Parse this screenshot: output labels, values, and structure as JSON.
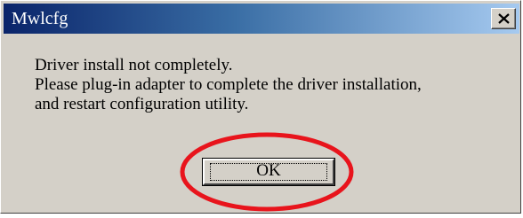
{
  "window": {
    "title": "Mwlcfg",
    "close_glyph": "X"
  },
  "message": {
    "lines": [
      "Driver install not completely.",
      "Please plug-in adapter to complete the driver installation,",
      "and restart configuration utility."
    ]
  },
  "buttons": {
    "ok_label": "OK"
  },
  "colors": {
    "title_gradient_start": "#0a246a",
    "title_gradient_end": "#a6caf0",
    "dialog_face": "#d4d0c8",
    "annotation": "#e8141c"
  },
  "icons": {
    "close": "close-icon",
    "annotation": "red-ellipse-annotation"
  }
}
